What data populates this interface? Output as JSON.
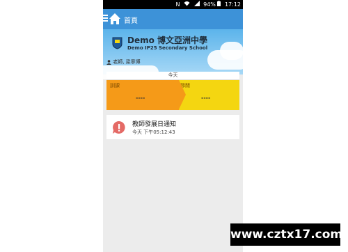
{
  "status_bar": {
    "battery": "94%",
    "time": "17:12",
    "icons": [
      "nfc-icon",
      "wifi-icon",
      "signal-icon",
      "battery-icon"
    ]
  },
  "app_bar": {
    "title": "首頁",
    "color": "#3d92d8"
  },
  "school": {
    "name": "Demo 博文亞洲中學",
    "name_en": "Demo IP25 Secondary School"
  },
  "teacher": {
    "label": "老師, 梁寧博"
  },
  "schedule": {
    "day": "今天",
    "current_label": "訓課",
    "current_value": "----",
    "next_label": "節閒",
    "next_value": "----",
    "current_color": "#f59a18",
    "next_color": "#f4d611"
  },
  "notifications": [
    {
      "title": "教師發展日通知",
      "time": "今天 下午05:12:43",
      "icon": "alert-bubble-icon"
    }
  ],
  "watermark": "www.cztx17.com"
}
